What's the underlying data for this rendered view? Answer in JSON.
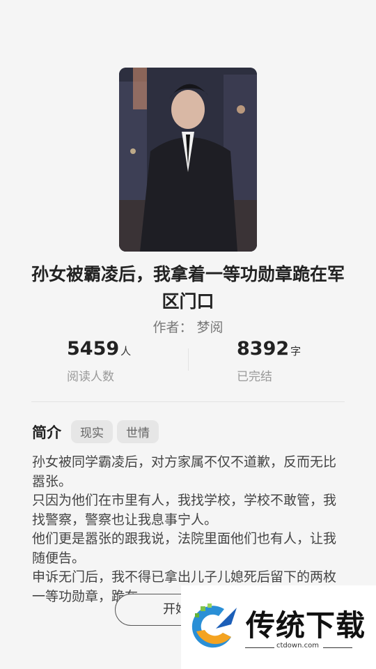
{
  "book": {
    "title": "孙女被霸凌后，我拿着一等功勋章跪在军区门口",
    "author_label": "作者：",
    "author": "梦阅"
  },
  "stats": [
    {
      "value": "5459",
      "unit": "人",
      "label": "阅读人数"
    },
    {
      "value": "8392",
      "unit": "字",
      "label": "已完结"
    }
  ],
  "intro": {
    "heading": "简介",
    "tags": [
      "现实",
      "世情"
    ],
    "text": "孙女被同学霸凌后，对方家属不仅不道歉，反而无比嚣张。\n只因为他们在市里有人，我找学校，学校不敢管，我找警察，警察也让我息事宁人。\n他们更是嚣张的跟我说，法院里面他们也有人，让我随便告。\n申诉无门后，我不得已拿出儿子儿媳死后留下的两枚一等功勋章，跪在"
  },
  "actions": {
    "start_label": "开始阅读"
  },
  "watermark": {
    "brand": "传统下载",
    "url": "ctdown.com"
  }
}
